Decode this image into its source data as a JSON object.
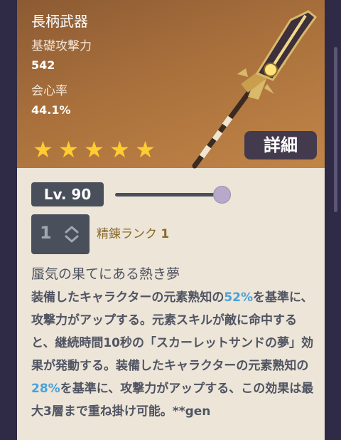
{
  "weapon": {
    "type": "長柄武器",
    "stat1_label": "基礎攻撃力",
    "stat1_value": "542",
    "stat2_label": "会心率",
    "stat2_value": "44.1%",
    "rarity_stars": 5,
    "detail_button": "詳細"
  },
  "level": {
    "label": "Lv. 90",
    "slider_fraction": 1.0
  },
  "refine": {
    "current": "1",
    "label": "精錬ランク",
    "rank": "1"
  },
  "passive": {
    "title": "蜃気の果てにある熱き夢",
    "p1": "装備したキャラクターの元素熟知の",
    "v1": "52%",
    "p2": "を基準に、攻撃力がアップする。元素スキルが敵に命中すると、継続時間10秒の「スカーレットサンドの夢」効果が発動する。装備したキャラクターの元素熟知の",
    "v2": "28%",
    "p3": "を基準に、攻撃力がアップする、この効果は最大3層まで重ね掛け可能。**gen"
  },
  "colors": {
    "header": "#a9703c",
    "highlight": "#4aa1d8",
    "star": "#ffcc32",
    "card_bg": "#ece5d8",
    "page_bg": "#2f2a45"
  }
}
